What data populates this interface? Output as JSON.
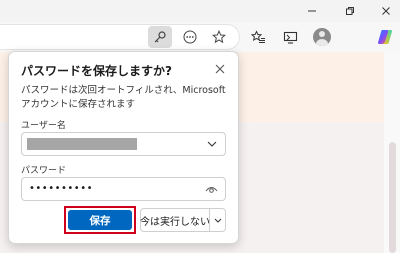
{
  "colors": {
    "primary_button": "#0067c0",
    "highlight_border": "#d0021b",
    "page_band": "#fdf1e7"
  },
  "icons": {
    "minimize": "minimize-icon",
    "restore": "restore-icon",
    "close": "close-icon",
    "key": "key-icon",
    "more": "more-icon",
    "favorite": "star-icon",
    "favorites": "favorites-icon",
    "collections": "collections-icon",
    "profile": "profile-icon",
    "copilot": "copilot-icon"
  },
  "popup": {
    "title": "パスワードを保存しますか?",
    "description": "パスワードは次回オートフィルされ、Microsoft アカウントに保存されます",
    "username_label": "ユーザー名",
    "password_label": "パスワード",
    "password_value": "••••••••••",
    "save_label": "保存",
    "not_now_label": "今は実行しない"
  }
}
